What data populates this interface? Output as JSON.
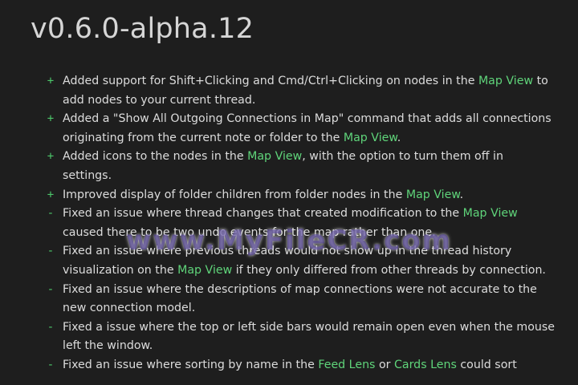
{
  "title": "v0.6.0-alpha.12",
  "markers": {
    "added": "+",
    "fixed": "-"
  },
  "colors": {
    "background": "#1e1e1e",
    "text": "#dcdcdc",
    "accent_link": "#5fd47a",
    "marker": "#4cc66a"
  },
  "entries": [
    {
      "type": "added",
      "parts": [
        {
          "text": "Added support for Shift+Clicking and Cmd/Ctrl+Clicking on nodes in the "
        },
        {
          "text": "Map View",
          "link": true
        },
        {
          "text": " to add nodes to your current thread."
        }
      ]
    },
    {
      "type": "added",
      "parts": [
        {
          "text": "Added a \"Show All Outgoing Connections in Map\" command that adds all connections originating from the current note or folder to the "
        },
        {
          "text": "Map View",
          "link": true
        },
        {
          "text": "."
        }
      ]
    },
    {
      "type": "added",
      "parts": [
        {
          "text": "Added icons to the nodes in the "
        },
        {
          "text": "Map View",
          "link": true
        },
        {
          "text": ", with the option to turn them off in settings."
        }
      ]
    },
    {
      "type": "added",
      "parts": [
        {
          "text": "Improved display of folder children from folder nodes in the "
        },
        {
          "text": "Map View",
          "link": true
        },
        {
          "text": "."
        }
      ]
    },
    {
      "type": "fixed",
      "parts": [
        {
          "text": "Fixed an issue where thread changes that created modification to the "
        },
        {
          "text": "Map View",
          "link": true
        },
        {
          "text": " caused there to be two undo events for the map rather than one."
        }
      ]
    },
    {
      "type": "fixed",
      "parts": [
        {
          "text": "Fixed an issue where previous threads would not show up in the thread history visualization on the "
        },
        {
          "text": "Map View",
          "link": true
        },
        {
          "text": " if they only differed from other threads by connection."
        }
      ]
    },
    {
      "type": "fixed",
      "parts": [
        {
          "text": "Fixed an issue where the descriptions of map connections were not accurate to the new connection model."
        }
      ]
    },
    {
      "type": "fixed",
      "parts": [
        {
          "text": "Fixed a issue where the top or left side bars would remain open even when the mouse left the window."
        }
      ]
    },
    {
      "type": "fixed",
      "parts": [
        {
          "text": "Fixed an issue where sorting by name in the "
        },
        {
          "text": "Feed Lens",
          "link": true
        },
        {
          "text": " or "
        },
        {
          "text": "Cards Lens",
          "link": true
        },
        {
          "text": " could sort"
        }
      ]
    }
  ],
  "watermark": "www.MyFileCR.com"
}
